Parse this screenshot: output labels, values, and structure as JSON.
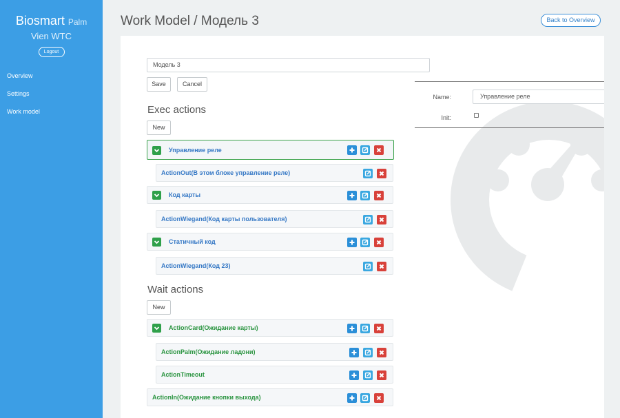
{
  "sidebar": {
    "brand": "Biosmart",
    "brand_sub": "Palm",
    "org": "Vien WTC",
    "logout": "Logout",
    "nav": [
      "Overview",
      "Settings",
      "Work model"
    ]
  },
  "header": {
    "title": "Work Model / Модель 3",
    "back": "Back to Overview"
  },
  "form": {
    "model_name": "Модель 3",
    "save": "Save",
    "cancel": "Cancel"
  },
  "exec": {
    "title": "Exec actions",
    "new": "New",
    "items": [
      "Управление реле",
      "ActionOut(В этом блоке управление реле)",
      "Код карты",
      "ActionWiegand(Код карты пользователя)",
      "Статичный код",
      "ActionWiegand(Код 23)"
    ]
  },
  "wait": {
    "title": "Wait actions",
    "new": "New",
    "items": [
      "ActionCard(Ожидание карты)",
      "ActionPalm(Ожидание ладони)",
      "ActionTimeout",
      "ActionIn(Ожидание кнопки выхода)"
    ]
  },
  "props": {
    "name_label": "Name:",
    "name_value": "Управление реле",
    "init_label": "Init:",
    "init_checked": false
  },
  "colors": {
    "sidebar": "#3c9ee5",
    "selected_border": "#3aa24a",
    "exec_text": "#3578c5",
    "wait_text": "#2a9440",
    "add_button": "#2b8fd8",
    "edit_button": "#39a7e0",
    "delete_button": "#d8413a"
  }
}
